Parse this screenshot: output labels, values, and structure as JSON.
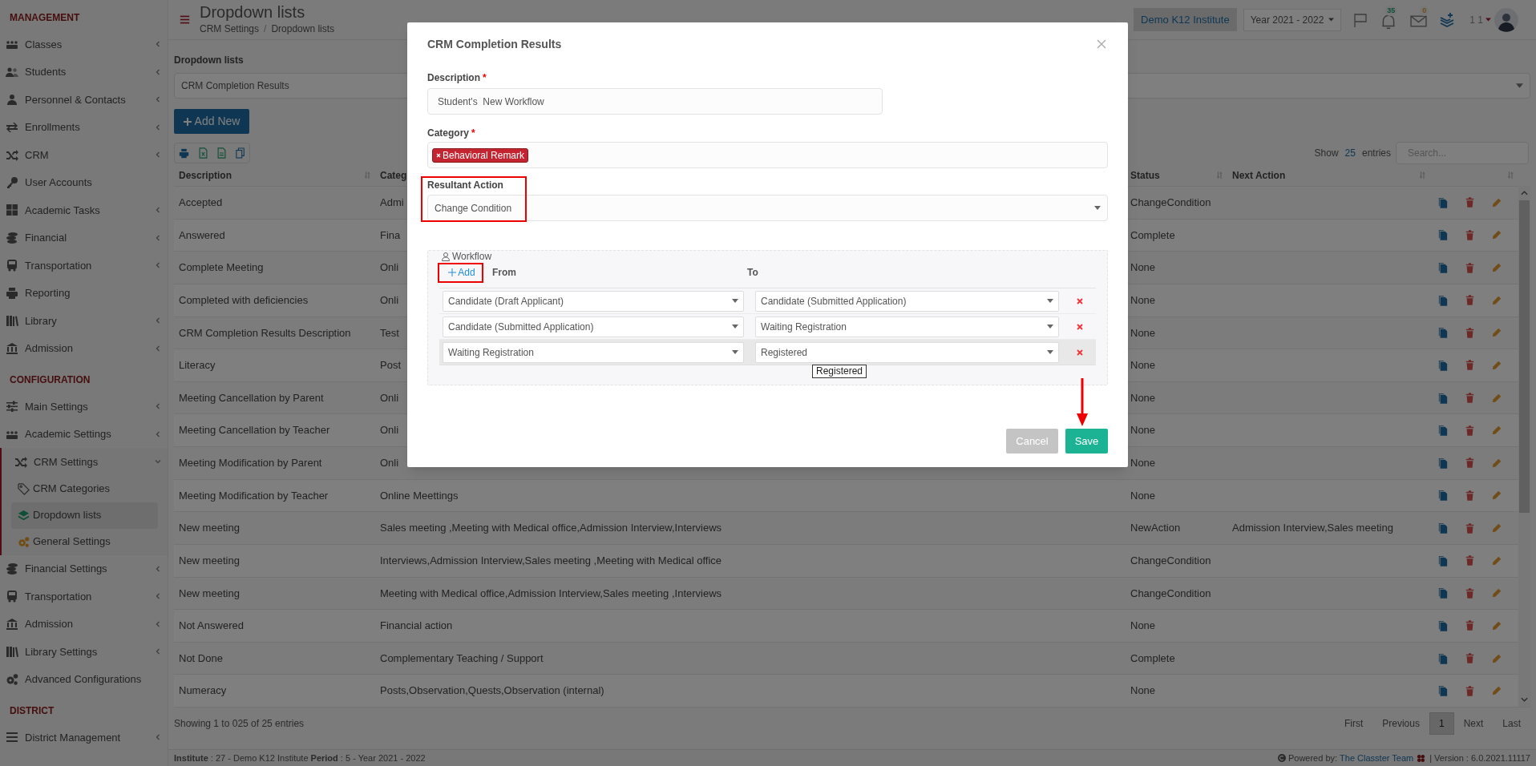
{
  "header": {
    "title": "Dropdown lists",
    "breadcrumb": [
      "CRM Settings",
      "Dropdown lists"
    ],
    "separator": "/",
    "institute": "Demo K12 Institute",
    "year": "Year 2021 - 2022",
    "notifications": "35",
    "messages": "0",
    "user": "1 1"
  },
  "sidebar": {
    "sections": [
      {
        "title": "MANAGEMENT",
        "items": [
          {
            "label": "Classes",
            "kind": "group",
            "expanded": false
          },
          {
            "label": "Students",
            "kind": "group",
            "expanded": false
          },
          {
            "label": "Personnel & Contacts",
            "kind": "group",
            "expanded": false
          },
          {
            "label": "Enrollments",
            "kind": "group",
            "expanded": false
          },
          {
            "label": "CRM",
            "kind": "group",
            "expanded": false
          },
          {
            "label": "User Accounts",
            "kind": "link"
          },
          {
            "label": "Academic Tasks",
            "kind": "group",
            "expanded": false
          },
          {
            "label": "Financial",
            "kind": "group",
            "expanded": false
          },
          {
            "label": "Transportation",
            "kind": "group",
            "expanded": false
          },
          {
            "label": "Reporting",
            "kind": "link"
          },
          {
            "label": "Library",
            "kind": "group",
            "expanded": false
          },
          {
            "label": "Admission",
            "kind": "group",
            "expanded": false
          }
        ]
      },
      {
        "title": "CONFIGURATION",
        "items": [
          {
            "label": "Main Settings",
            "kind": "group",
            "expanded": false
          },
          {
            "label": "Academic Settings",
            "kind": "group",
            "expanded": false
          },
          {
            "label": "CRM Settings",
            "kind": "group",
            "expanded": true,
            "children": [
              {
                "label": "CRM Categories",
                "selected": false
              },
              {
                "label": "Dropdown lists",
                "selected": true
              },
              {
                "label": "General Settings",
                "selected": false
              }
            ]
          },
          {
            "label": "Financial Settings",
            "kind": "group",
            "expanded": false
          },
          {
            "label": "Transportation",
            "kind": "group",
            "expanded": false
          },
          {
            "label": "Admission",
            "kind": "group",
            "expanded": false
          },
          {
            "label": "Library Settings",
            "kind": "group",
            "expanded": false
          },
          {
            "label": "Advanced Configurations",
            "kind": "link"
          }
        ]
      },
      {
        "title": "DISTRICT",
        "items": [
          {
            "label": "District Management",
            "kind": "group",
            "expanded": false
          }
        ]
      }
    ]
  },
  "list_picker": {
    "label": "Dropdown lists",
    "value": "CRM Completion Results"
  },
  "add_button": "Add New",
  "table_controls": {
    "show": "Show",
    "page_size": "25",
    "entries": "entries",
    "search_placeholder": "Search..."
  },
  "table": {
    "columns": [
      "Description",
      "Categ",
      "Status",
      "Next Action"
    ],
    "rows": [
      {
        "description": "Accepted",
        "category": "Admi",
        "status": "ChangeCondition"
      },
      {
        "description": "Answered",
        "category": "Fina",
        "status": "Complete"
      },
      {
        "description": "Complete Meeting",
        "category": "Onli",
        "status": "None"
      },
      {
        "description": "Completed with deficiencies",
        "category": "Onli",
        "status": "None"
      },
      {
        "description": "CRM Completion Results Description",
        "category": "Test",
        "status": "None"
      },
      {
        "description": "Literacy",
        "category": "Post",
        "status": "None"
      },
      {
        "description": "Meeting Cancellation by Parent",
        "category": "Onli",
        "status": "None"
      },
      {
        "description": "Meeting Cancellation by Teacher",
        "category": "Onli",
        "status": "None"
      },
      {
        "description": "Meeting Modification by Parent",
        "category": "Onli",
        "status": "None"
      },
      {
        "description": "Meeting Modification by Teacher",
        "category": "Online Meettings",
        "status": "None"
      },
      {
        "description": "New meeting",
        "category": "Sales meeting ,Meeting with Medical office,Admission Interview,Interviews",
        "status": "NewAction",
        "next_action": "Admission Interview,Sales meeting"
      },
      {
        "description": "New meeting",
        "category": "Interviews,Admission Interview,Sales meeting ,Meeting with Medical office",
        "status": "ChangeCondition"
      },
      {
        "description": "New meeting",
        "category": "Meeting with Medical office,Admission Interview,Sales meeting ,Interviews",
        "status": "ChangeCondition"
      },
      {
        "description": "Not Answered",
        "category": "Financial action",
        "status": "None"
      },
      {
        "description": "Not Done",
        "category": "Complementary Teaching / Support",
        "status": "Complete"
      },
      {
        "description": "Numeracy",
        "category": "Posts,Observation,Quests,Observation (internal)",
        "status": "None"
      }
    ]
  },
  "table_info": "Showing 1 to 025 of 25 entries",
  "pagination": [
    {
      "label": "First",
      "selected": false
    },
    {
      "label": "Previous",
      "selected": false
    },
    {
      "label": "1",
      "selected": true
    },
    {
      "label": "Next",
      "selected": false
    },
    {
      "label": "Last",
      "selected": false
    }
  ],
  "footer": {
    "info": "**Institute** : 27 - Demo K12 Institute **Period** : 5 - Year 2021 - 2022",
    "powered_by": "Powered by:",
    "team": "The Classter Team",
    "version": "| Version : 6.0.2021.11117"
  },
  "modal": {
    "title": "CRM Completion Results",
    "description": {
      "label": "Description",
      "required_mark": "*",
      "value": "Student's  New Workflow"
    },
    "category": {
      "label": "Category",
      "required_mark": "*",
      "tags": [
        "Behavioral Remark"
      ]
    },
    "resultant_action": {
      "label": "Resultant Action",
      "value": "Change Condition"
    },
    "workflow": {
      "legend": "Workflow",
      "add": "Add",
      "from_header": "From",
      "to_header": "To",
      "rows": [
        {
          "from": "Candidate (Draft Applicant)",
          "to": "Candidate (Submitted Application)",
          "hovered": false
        },
        {
          "from": "Candidate (Submitted Application)",
          "to": "Waiting Registration",
          "hovered": false
        },
        {
          "from": "Waiting Registration",
          "to": "Registered",
          "hovered": true,
          "tooltip": "Registered"
        }
      ]
    },
    "buttons": {
      "cancel": "Cancel",
      "save": "Save"
    }
  }
}
